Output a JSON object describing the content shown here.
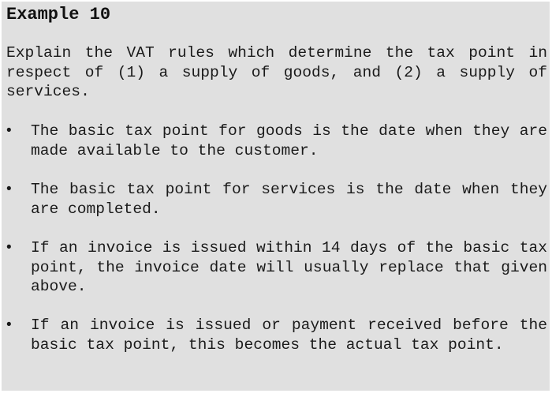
{
  "title": "Example 10",
  "intro": "Explain the VAT rules which determine the tax point in respect of (1) a supply of goods, and (2) a supply of services.",
  "bullet_glyph": "•",
  "bullets": [
    "The basic tax point for goods is the date when they are made available to the customer.",
    "The basic tax point for services is the date when they are completed.",
    "If an invoice is issued within 14 days of the basic tax point, the invoice date will usually replace that given above.",
    "If an invoice is issued or payment received before the basic tax point, this becomes the actual tax point."
  ]
}
